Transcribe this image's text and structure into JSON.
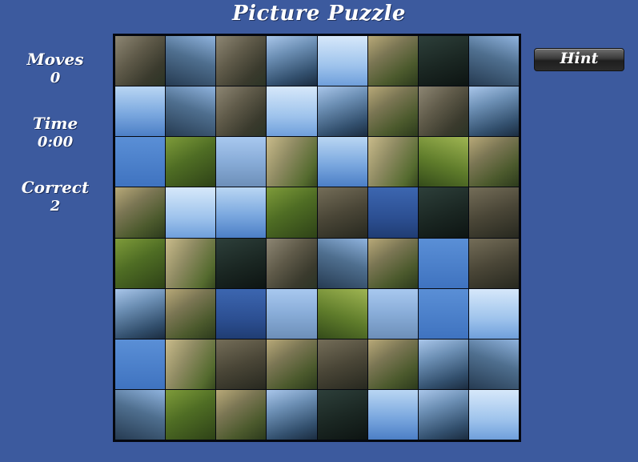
{
  "title": "Picture Puzzle",
  "stats": {
    "moves_label": "Moves",
    "moves_value": "0",
    "time_label": "Time",
    "time_value": "0:00",
    "correct_label": "Correct",
    "correct_value": "2"
  },
  "hint_label": "Hint",
  "colors": {
    "background": "#3c5a9e",
    "board_border": "#050810",
    "text": "#ffffff"
  },
  "board": {
    "rows": 8,
    "cols": 8,
    "tiles": [
      "rock",
      "mtn2",
      "rock",
      "mtn",
      "sky2",
      "ruin",
      "dark",
      "mtn2",
      "sky",
      "mtn2",
      "rock",
      "sky2",
      "mtn",
      "ruin",
      "rock",
      "mtn",
      "sky3",
      "green",
      "haze",
      "ruin2",
      "sky",
      "ruin2",
      "green2",
      "ruin",
      "ruin",
      "sky2",
      "sky",
      "green",
      "rock2",
      "blue",
      "dark",
      "rock2",
      "green",
      "ruin2",
      "dark",
      "rock",
      "mtn2",
      "ruin",
      "sky3",
      "rock2",
      "mtn",
      "ruin",
      "blue",
      "haze",
      "green2",
      "haze",
      "sky3",
      "sky2",
      "sky3",
      "ruin2",
      "rock2",
      "ruin",
      "rock2",
      "ruin",
      "mtn",
      "mtn2",
      "mtn2",
      "green",
      "ruin",
      "mtn",
      "dark",
      "sky",
      "mtn",
      "sky2"
    ]
  }
}
